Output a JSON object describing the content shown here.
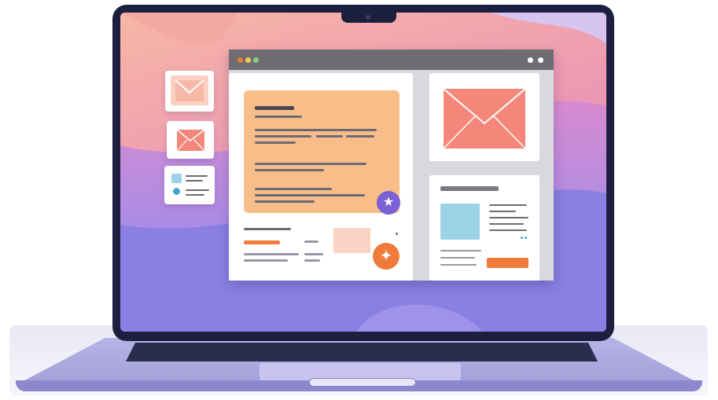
{
  "colors": {
    "lid": "#1d1f3e",
    "window_titlebar": "#6f6d72",
    "document_card": "#f8bd88",
    "accent_orange": "#f07a3a",
    "accent_purple": "#7a62d6",
    "envelope": "#f4877a",
    "image_placeholder": "#9dd3e6"
  },
  "icons": {
    "star": "star-icon",
    "add": "add-icon",
    "envelope": "envelope-icon"
  }
}
